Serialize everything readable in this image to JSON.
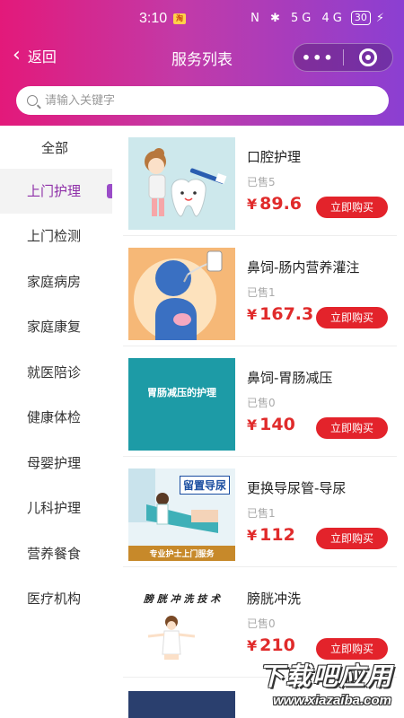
{
  "status_bar": {
    "time": "3:10",
    "notification_badge": "淘",
    "network_icons": "N ✱ 5G 4G",
    "battery": "30"
  },
  "navbar": {
    "back_label": "返回",
    "title": "服务列表",
    "more_icon": "more-dots-icon",
    "close_icon": "target-close-icon"
  },
  "search": {
    "placeholder": "请输入关键字",
    "value": ""
  },
  "categories": [
    {
      "label": "全部"
    },
    {
      "label": "上门护理",
      "active": true
    },
    {
      "label": "上门检测"
    },
    {
      "label": "家庭病房"
    },
    {
      "label": "家庭康复"
    },
    {
      "label": "就医陪诊"
    },
    {
      "label": "健康体检"
    },
    {
      "label": "母婴护理"
    },
    {
      "label": "儿科护理"
    },
    {
      "label": "营养餐食"
    },
    {
      "label": "医疗机构"
    }
  ],
  "products": [
    {
      "name": "口腔护理",
      "sold": "已售5",
      "currency": "¥",
      "price": "89.6",
      "buy_label": "立即购买"
    },
    {
      "name": "鼻饲-肠内营养灌注",
      "sold": "已售1",
      "currency": "¥",
      "price": "167.3",
      "buy_label": "立即购买"
    },
    {
      "name": "鼻饲-胃肠减压",
      "sold": "已售0",
      "currency": "¥",
      "price": "140",
      "buy_label": "立即购买",
      "thumb_text": "胃肠减压的护理"
    },
    {
      "name": "更换导尿管-导尿",
      "sold": "已售1",
      "currency": "¥",
      "price": "112",
      "buy_label": "立即购买",
      "thumb_top_text": "留置导尿",
      "thumb_bottom_text": "专业护士上门服务"
    },
    {
      "name": "膀胱冲洗",
      "sold": "已售0",
      "currency": "¥",
      "price": "210",
      "buy_label": "立即购买",
      "thumb_text": "膀 胱 冲 洗 技 术"
    }
  ],
  "watermark": {
    "title": "下载吧应用",
    "url": "www.xiazaiba.com"
  },
  "colors": {
    "accent_purple": "#8e2fa8",
    "price_red": "#e02b2b",
    "buy_button": "#e3232b"
  }
}
